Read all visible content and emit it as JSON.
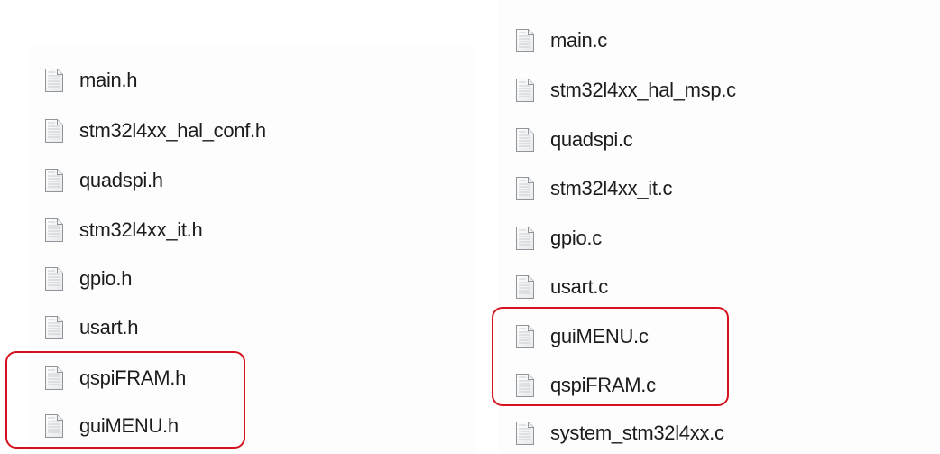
{
  "header_files": {
    "items": [
      {
        "name": "main.h",
        "icon": "text-file-icon"
      },
      {
        "name": "stm32l4xx_hal_conf.h",
        "icon": "text-file-icon"
      },
      {
        "name": "quadspi.h",
        "icon": "text-file-icon"
      },
      {
        "name": "stm32l4xx_it.h",
        "icon": "text-file-icon"
      },
      {
        "name": "gpio.h",
        "icon": "text-file-icon"
      },
      {
        "name": "usart.h",
        "icon": "text-file-icon"
      },
      {
        "name": "qspiFRAM.h",
        "icon": "text-file-icon"
      },
      {
        "name": "guiMENU.h",
        "icon": "text-file-icon"
      }
    ]
  },
  "source_files": {
    "items": [
      {
        "name": "main.c",
        "icon": "text-file-icon"
      },
      {
        "name": "stm32l4xx_hal_msp.c",
        "icon": "text-file-icon"
      },
      {
        "name": "quadspi.c",
        "icon": "text-file-icon"
      },
      {
        "name": "stm32l4xx_it.c",
        "icon": "text-file-icon"
      },
      {
        "name": "gpio.c",
        "icon": "text-file-icon"
      },
      {
        "name": "usart.c",
        "icon": "text-file-icon"
      },
      {
        "name": "guiMENU.c",
        "icon": "text-file-icon"
      },
      {
        "name": "qspiFRAM.c",
        "icon": "text-file-icon"
      },
      {
        "name": "system_stm32l4xx.c",
        "icon": "text-file-icon"
      }
    ]
  },
  "colors": {
    "highlight": "#d6121e",
    "text": "#1c1c1c"
  }
}
